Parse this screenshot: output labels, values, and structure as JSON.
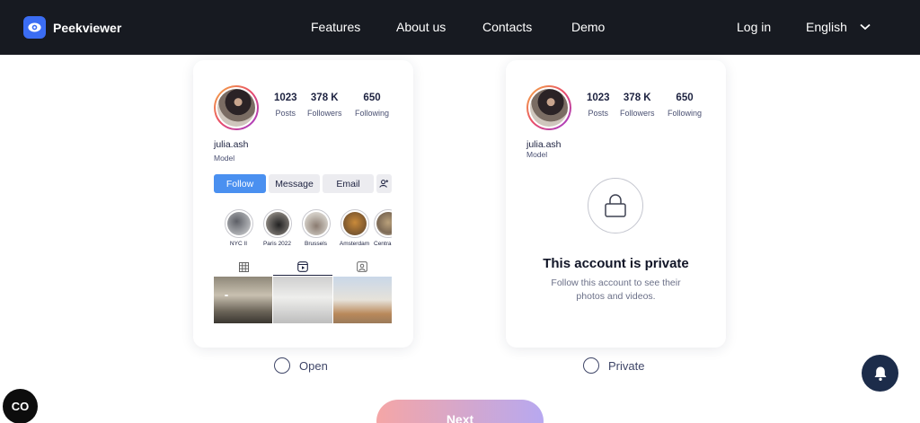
{
  "nav": {
    "brand": "Peekviewer",
    "links": [
      "Features",
      "About us",
      "Contacts",
      "Demo"
    ],
    "login": "Log in",
    "language": "English"
  },
  "profile": {
    "posts": "1023",
    "posts_label": "Posts",
    "followers": "378 K",
    "followers_label": "Followers",
    "following": "650",
    "following_label": "Following",
    "username": "julia.ash",
    "role": "Model"
  },
  "open_card": {
    "buttons": {
      "follow": "Follow",
      "message": "Message",
      "email": "Email"
    },
    "highlights": [
      "NYC II",
      "Paris 2022",
      "Brussels",
      "Amsterdam",
      "Centra"
    ]
  },
  "private_card": {
    "title": "This account is private",
    "subtitle": "Follow this account to see their photos and videos."
  },
  "options": {
    "open": "Open",
    "private": "Private"
  },
  "next_button": "Next",
  "chat_badge": "CO",
  "colors": {
    "accent": "#4a90f0",
    "nav_bg": "#171a21",
    "logo": "#3b6df3",
    "bell_bg": "#1c2c4a"
  }
}
